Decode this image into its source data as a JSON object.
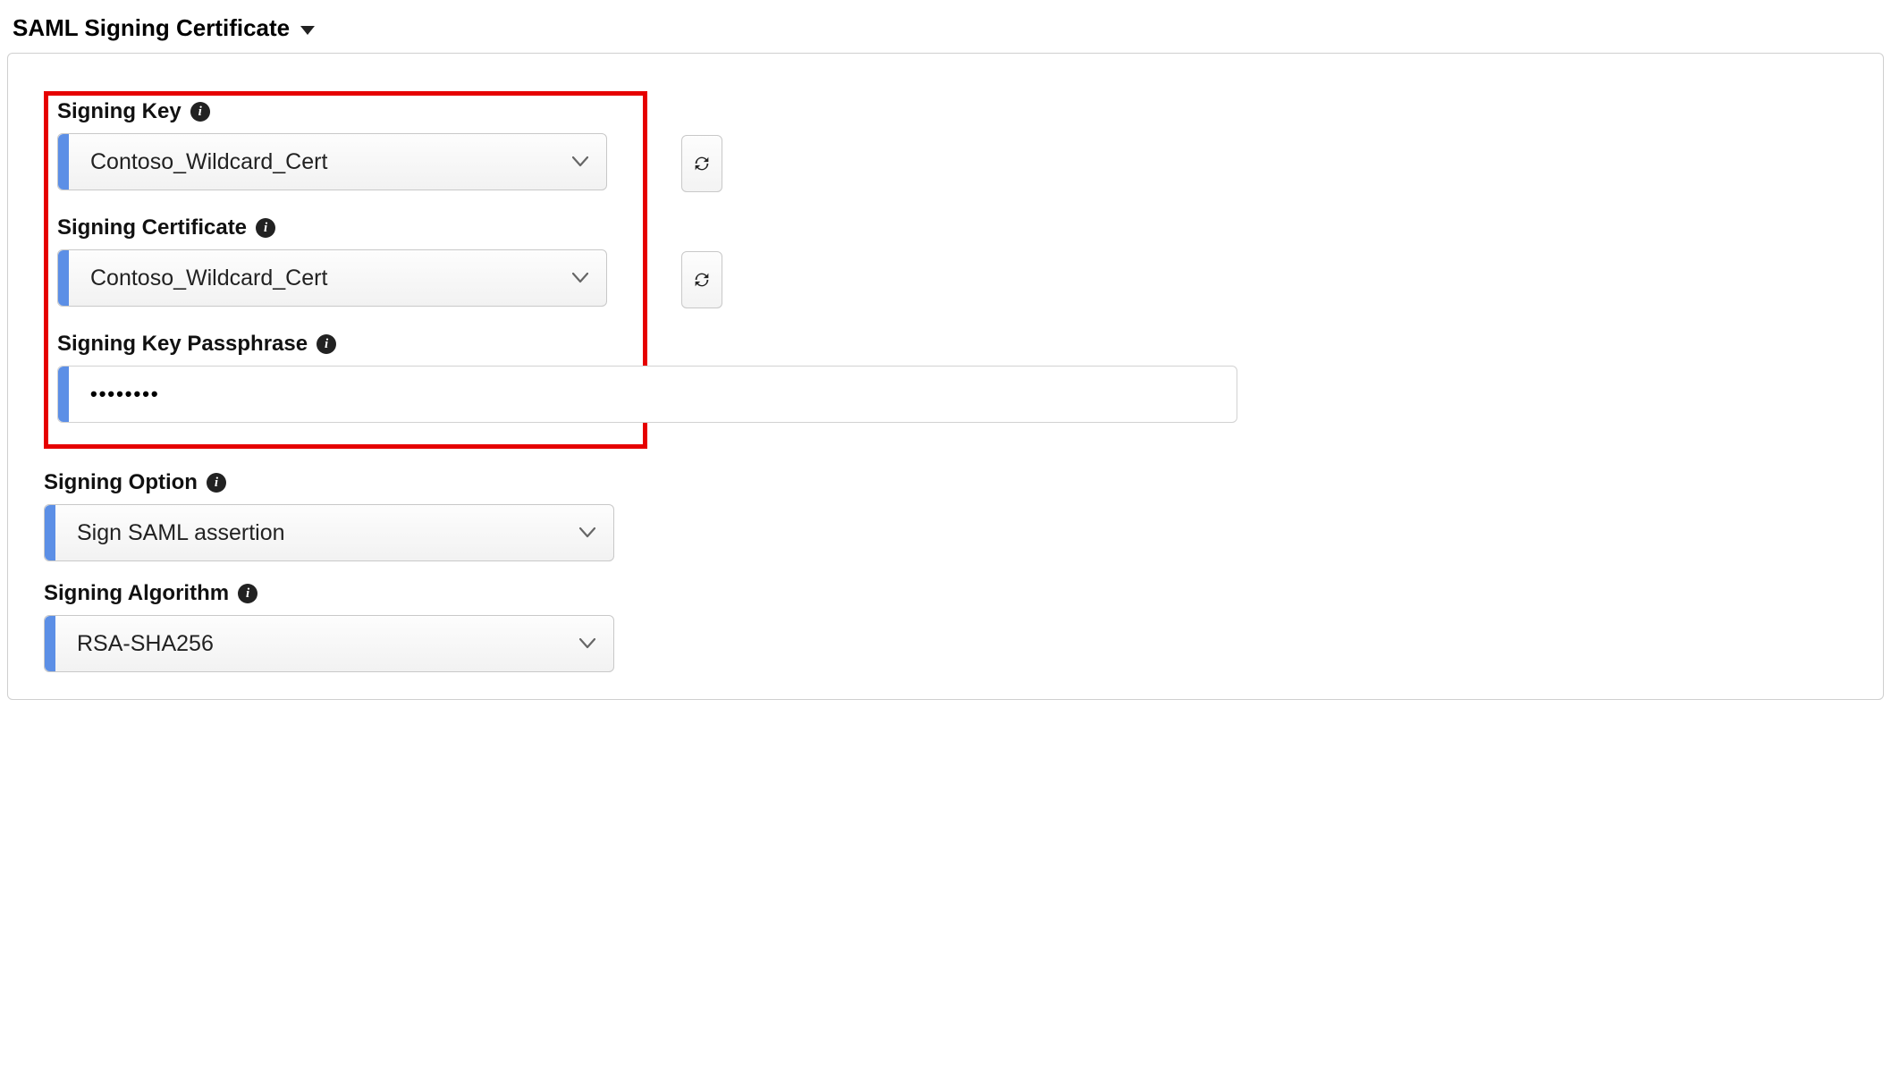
{
  "section": {
    "title": "SAML Signing Certificate"
  },
  "fields": {
    "signing_key": {
      "label": "Signing Key",
      "value": "Contoso_Wildcard_Cert"
    },
    "signing_certificate": {
      "label": "Signing Certificate",
      "value": "Contoso_Wildcard_Cert"
    },
    "signing_key_passphrase": {
      "label": "Signing Key Passphrase",
      "value": "••••••••"
    },
    "signing_option": {
      "label": "Signing Option",
      "value": "Sign SAML assertion"
    },
    "signing_algorithm": {
      "label": "Signing Algorithm",
      "value": "RSA-SHA256"
    }
  }
}
